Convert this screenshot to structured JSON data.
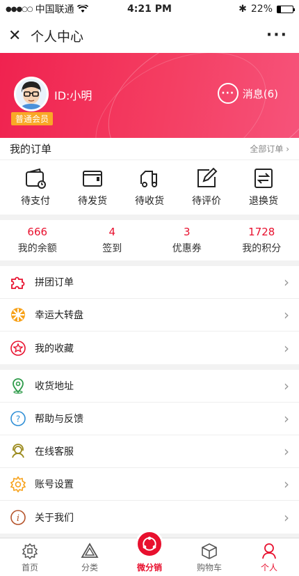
{
  "status": {
    "carrier": "中国联通",
    "time": "4:21 PM",
    "battery": "22%",
    "battery_level": 0.22
  },
  "nav": {
    "title": "个人中心"
  },
  "profile": {
    "user_id": "ID:小明",
    "badge": "普通会员",
    "messages": "消息(6)"
  },
  "orders": {
    "title": "我的订单",
    "all": "全部订单",
    "items": [
      {
        "label": "待支付",
        "icon": "wallet-clock-icon"
      },
      {
        "label": "待发货",
        "icon": "wallet-icon"
      },
      {
        "label": "待收货",
        "icon": "truck-icon"
      },
      {
        "label": "待评价",
        "icon": "edit-icon"
      },
      {
        "label": "退换货",
        "icon": "exchange-icon"
      }
    ]
  },
  "stats": [
    {
      "value": "666",
      "label": "我的余额"
    },
    {
      "value": "4",
      "label": "签到"
    },
    {
      "value": "3",
      "label": "优惠券"
    },
    {
      "value": "1728",
      "label": "我的积分"
    }
  ],
  "menu_group1": [
    {
      "label": "拼团订单",
      "icon": "puzzle-icon"
    },
    {
      "label": "幸运大转盘",
      "icon": "wheel-icon"
    },
    {
      "label": "我的收藏",
      "icon": "star-icon"
    }
  ],
  "menu_group2": [
    {
      "label": "收货地址",
      "icon": "location-icon"
    },
    {
      "label": "帮助与反馈",
      "icon": "help-icon"
    },
    {
      "label": "在线客服",
      "icon": "service-icon"
    },
    {
      "label": "账号设置",
      "icon": "settings-icon"
    },
    {
      "label": "关于我们",
      "icon": "info-icon"
    }
  ],
  "tabs": [
    {
      "label": "首页",
      "icon": "home-icon"
    },
    {
      "label": "分类",
      "icon": "category-icon"
    },
    {
      "label": "微分销",
      "icon": "share-icon"
    },
    {
      "label": "购物车",
      "icon": "cart-icon"
    },
    {
      "label": "个人",
      "icon": "user-icon"
    }
  ],
  "colors": {
    "accent": "#e8102e",
    "badge": "#f9a826"
  }
}
